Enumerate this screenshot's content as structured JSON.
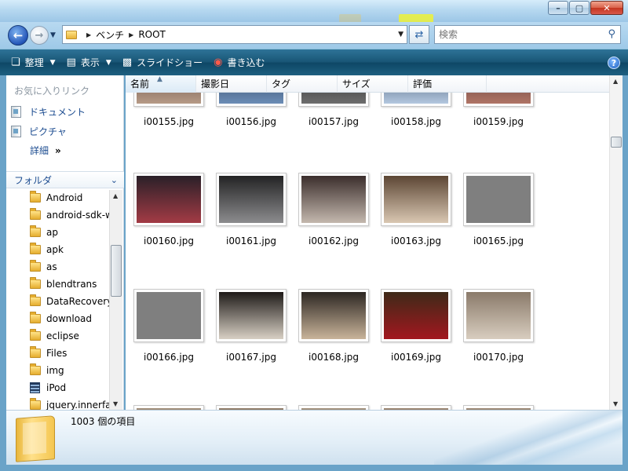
{
  "navigation": {
    "breadcrumbs": [
      "ベンチ",
      "ROOT"
    ],
    "search_placeholder": "検索"
  },
  "commands": {
    "organize": "整理",
    "view": "表示",
    "slideshow": "スライドショー",
    "burn": "書き込む"
  },
  "sidebar": {
    "favorites_header": "お気に入りリンク",
    "favorites": [
      "ドキュメント",
      "ピクチャ",
      "詳細"
    ],
    "folders_header": "フォルダ",
    "tree": [
      {
        "label": "Android",
        "icon": "folder-icon"
      },
      {
        "label": "android-sdk-w",
        "icon": "folder-icon"
      },
      {
        "label": "ap",
        "icon": "folder-icon"
      },
      {
        "label": "apk",
        "icon": "folder-icon"
      },
      {
        "label": "as",
        "icon": "folder-icon"
      },
      {
        "label": "blendtrans",
        "icon": "folder-icon"
      },
      {
        "label": "DataRecovery",
        "icon": "folder-icon"
      },
      {
        "label": "download",
        "icon": "folder-icon"
      },
      {
        "label": "eclipse",
        "icon": "folder-icon"
      },
      {
        "label": "Files",
        "icon": "folder-icon"
      },
      {
        "label": "img",
        "icon": "folder-icon"
      },
      {
        "label": "iPod",
        "icon": "video-folder-icon"
      },
      {
        "label": "jquery.innerfa",
        "icon": "folder-icon"
      }
    ]
  },
  "columns": [
    "名前",
    "撮影日",
    "タグ",
    "サイズ",
    "評価"
  ],
  "files": [
    {
      "name": "i00155.jpg",
      "colors": [
        "#4a3a32",
        "#b69a86"
      ]
    },
    {
      "name": "i00156.jpg",
      "colors": [
        "#1b2a44",
        "#6c8db6"
      ]
    },
    {
      "name": "i00157.jpg",
      "colors": [
        "#141414",
        "#6e6e6e"
      ]
    },
    {
      "name": "i00158.jpg",
      "colors": [
        "#1f3048",
        "#b4c8e0"
      ]
    },
    {
      "name": "i00159.jpg",
      "colors": [
        "#3c2a26",
        "#b07466"
      ]
    },
    {
      "name": "i00160.jpg",
      "colors": [
        "#2a2028",
        "#a33b45"
      ]
    },
    {
      "name": "i00161.jpg",
      "colors": [
        "#232324",
        "#8c8c8e"
      ]
    },
    {
      "name": "i00162.jpg",
      "colors": [
        "#3b2e2c",
        "#c4b8ae"
      ]
    },
    {
      "name": "i00163.jpg",
      "colors": [
        "#5c4634",
        "#d9c7b2"
      ]
    },
    {
      "name": "i00165.jpg",
      "colors": [
        "#7f7f7f",
        "#7f7f7f"
      ]
    },
    {
      "name": "i00166.jpg",
      "colors": [
        "#7f7f7f",
        "#7f7f7f"
      ]
    },
    {
      "name": "i00167.jpg",
      "colors": [
        "#1e1a18",
        "#d8d0c4"
      ]
    },
    {
      "name": "i00168.jpg",
      "colors": [
        "#2c2622",
        "#c9b49a"
      ]
    },
    {
      "name": "i00169.jpg",
      "colors": [
        "#3e2a18",
        "#a3171f"
      ]
    },
    {
      "name": "i00170.jpg",
      "colors": [
        "#8a7a6a",
        "#d8cdbf"
      ]
    },
    {
      "name": "",
      "colors": [
        "#9e8a76",
        "#d8c8b6"
      ]
    },
    {
      "name": "",
      "colors": [
        "#8e7a66",
        "#cdbda8"
      ]
    },
    {
      "name": "",
      "colors": [
        "#a08e7a",
        "#d6c6b4"
      ]
    },
    {
      "name": "",
      "colors": [
        "#98826e",
        "#d2c0ac"
      ]
    },
    {
      "name": "",
      "colors": [
        "#9a8672",
        "#d4c4b0"
      ]
    }
  ],
  "status": {
    "item_count": "1003 個の項目"
  },
  "colors": {
    "command_bar": "#195676",
    "link_text": "#1c4c90",
    "accent": "#2463c2"
  }
}
